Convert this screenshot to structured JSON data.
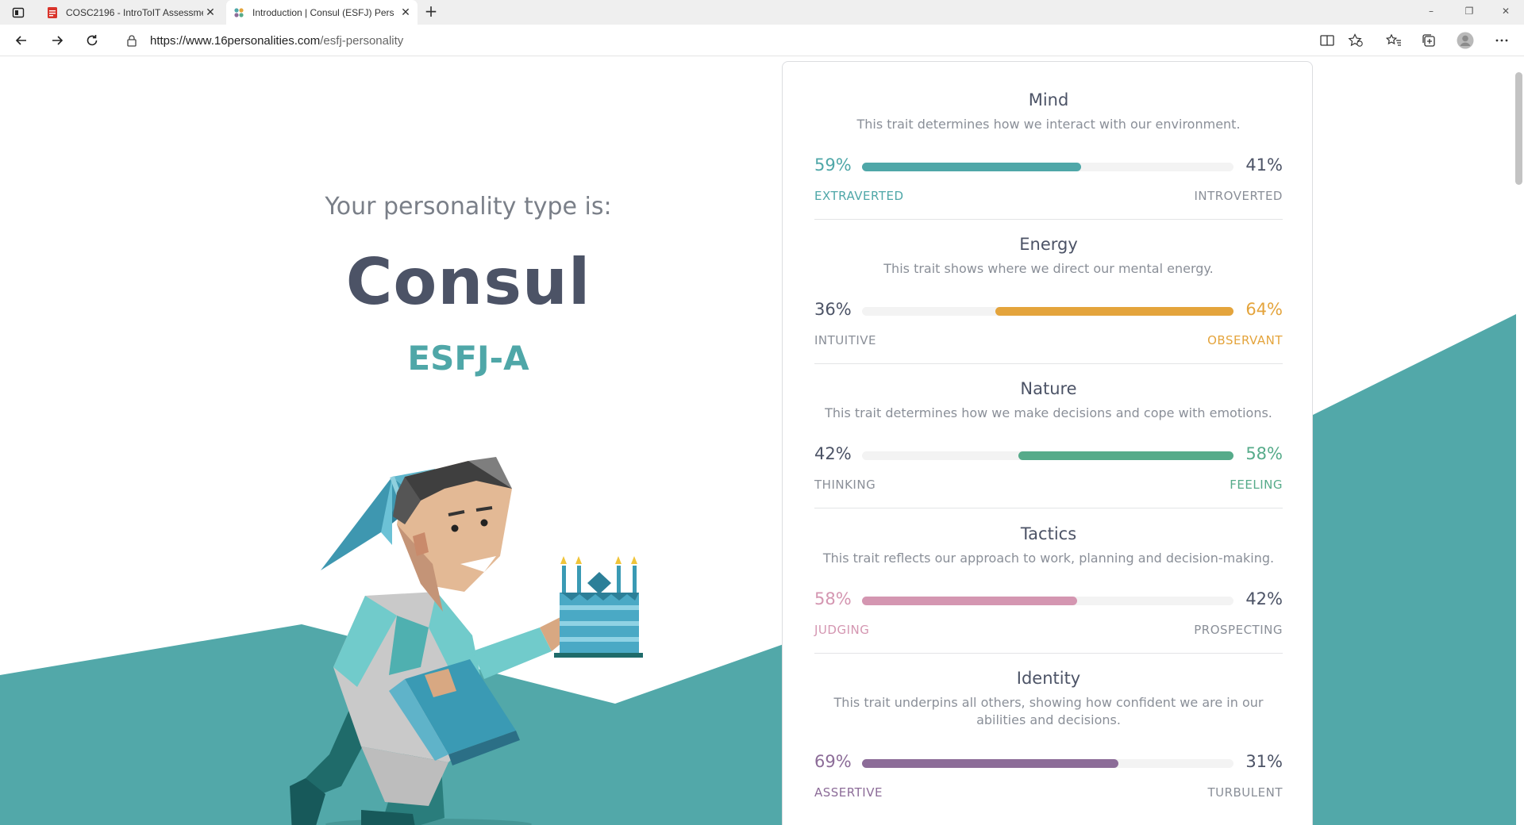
{
  "browser": {
    "tabs": [
      {
        "title": "COSC2196 - IntroToIT Assessmen",
        "active": false
      },
      {
        "title": "Introduction | Consul (ESFJ) Pers",
        "active": true
      }
    ],
    "address": {
      "url_host": "https://www.16personalities.com",
      "url_path": "/esfj-personality"
    },
    "window_controls": [
      "–",
      "❐",
      "✕"
    ]
  },
  "hero": {
    "intro": "Your personality type is:",
    "name": "Consul",
    "code": "ESFJ-A"
  },
  "colors": {
    "teal": "#4fa7a8",
    "orange": "#e4a43c",
    "green": "#56ab8a",
    "pink": "#d496b1",
    "purple": "#8c6c98",
    "dark_text": "#4c5366",
    "muted_text": "#8a8f98"
  },
  "traits": [
    {
      "title": "Mind",
      "description": "This trait determines how we interact with our environment.",
      "left_pct": "59%",
      "right_pct": "41%",
      "left_label": "EXTRAVERTED",
      "right_label": "INTROVERTED",
      "dominant": "left",
      "fill_fraction": 0.59,
      "color": "#4fa7a8"
    },
    {
      "title": "Energy",
      "description": "This trait shows where we direct our mental energy.",
      "left_pct": "36%",
      "right_pct": "64%",
      "left_label": "INTUITIVE",
      "right_label": "OBSERVANT",
      "dominant": "right",
      "fill_fraction": 0.64,
      "color": "#e4a43c"
    },
    {
      "title": "Nature",
      "description": "This trait determines how we make decisions and cope with emotions.",
      "left_pct": "42%",
      "right_pct": "58%",
      "left_label": "THINKING",
      "right_label": "FEELING",
      "dominant": "right",
      "fill_fraction": 0.58,
      "color": "#56ab8a"
    },
    {
      "title": "Tactics",
      "description": "This trait reflects our approach to work, planning and decision-making.",
      "left_pct": "58%",
      "right_pct": "42%",
      "left_label": "JUDGING",
      "right_label": "PROSPECTING",
      "dominant": "left",
      "fill_fraction": 0.58,
      "color": "#d496b1"
    },
    {
      "title": "Identity",
      "description": "This trait underpins all others, showing how confident we are in our abilities and decisions.",
      "left_pct": "69%",
      "right_pct": "31%",
      "left_label": "ASSERTIVE",
      "right_label": "TURBULENT",
      "dominant": "left",
      "fill_fraction": 0.69,
      "color": "#8c6c98"
    }
  ]
}
